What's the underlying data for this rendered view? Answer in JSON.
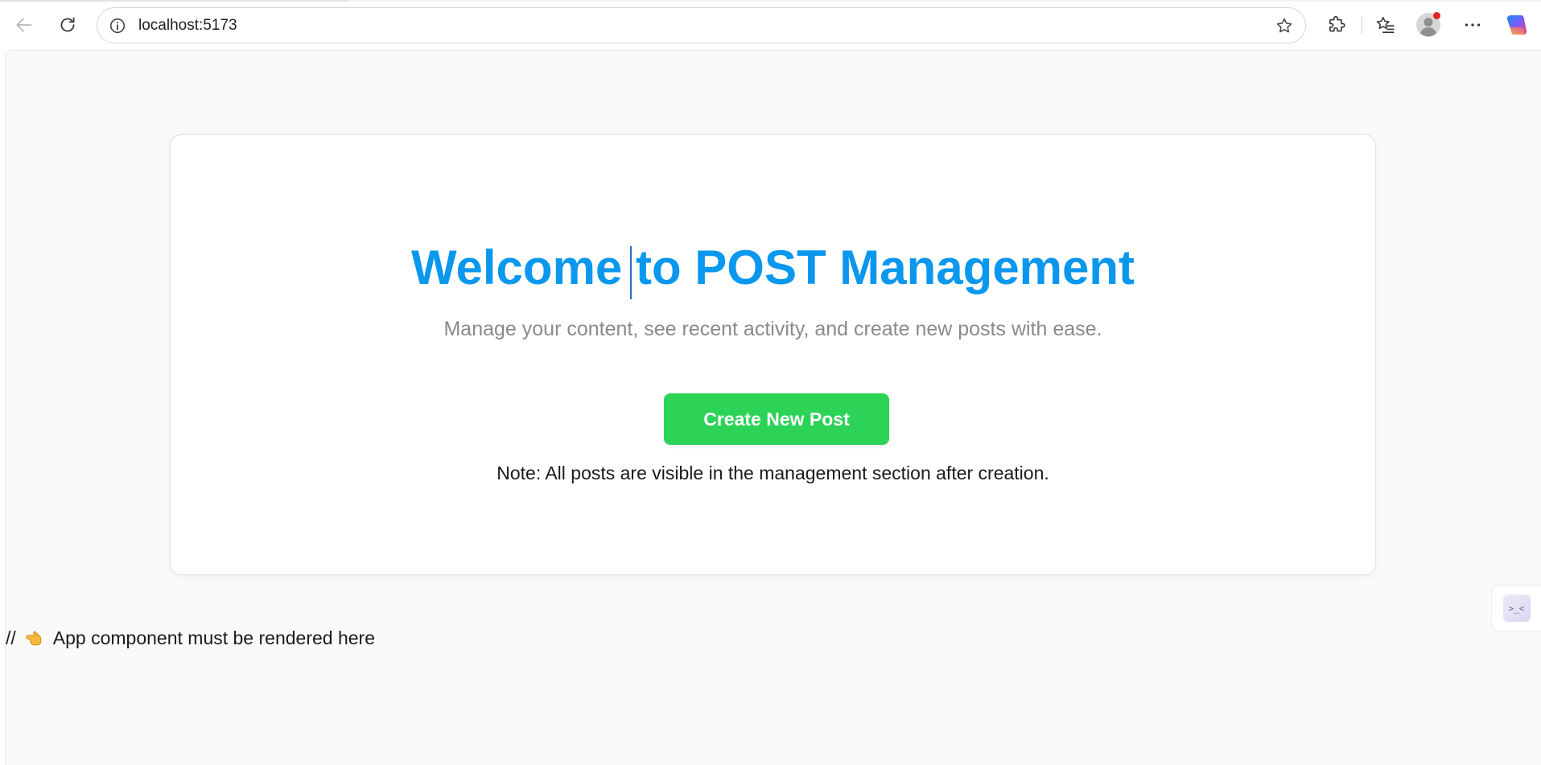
{
  "browser": {
    "url": "localhost:5173",
    "icons": {
      "back": "back-arrow-icon",
      "reload": "reload-icon",
      "info": "info-icon",
      "favorite": "star-icon",
      "extensions": "puzzle-icon",
      "favorites_bar": "favorites-icon",
      "profile": "avatar",
      "more": "more-icon",
      "copilot": "copilot-icon"
    },
    "colors": {
      "notification_dot": "#e3222a"
    }
  },
  "page": {
    "title": "Welcome to POST Management",
    "subtitle": "Manage your content, see recent activity, and create new posts with ease.",
    "create_button_label": "Create New Post",
    "note": "Note: All posts are visible in the management section after creation.",
    "footer_comment_prefix": "//",
    "footer_comment_text": "App component must be rendered here",
    "side_widget_glyph": ">_<",
    "colors": {
      "title": "#0a97ee",
      "button": "#2cd357",
      "subtitle": "#8a8a8a"
    }
  }
}
